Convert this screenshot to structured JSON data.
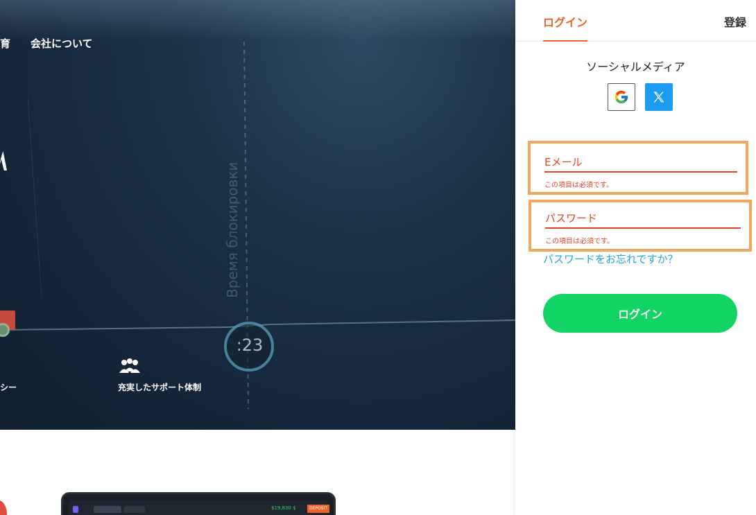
{
  "site": {
    "nav": [
      "育",
      "会社について"
    ],
    "features": [
      "シー",
      "充実したサポート体制"
    ],
    "chart_vertical_label": "Время блокировки",
    "timer": ":23"
  },
  "device_preview": {
    "balance": "$19,830 $",
    "deposit_label": "DEPOSIT"
  },
  "auth": {
    "tabs": {
      "login": "ログイン",
      "register": "登録"
    },
    "social_title": "ソーシャルメディア",
    "social_buttons": [
      {
        "icon": "google-icon",
        "label": "G"
      },
      {
        "icon": "x-icon",
        "label": "𝕏"
      }
    ],
    "email": {
      "label": "Eメール",
      "error": "この項目は必須です。"
    },
    "password": {
      "label": "パスワード",
      "error": "この項目は必須です。"
    },
    "forgot_link": "パスワードをお忘れですか？",
    "submit_label": "ログイン"
  },
  "colors": {
    "accent_orange": "#e8622a",
    "error_red": "#e04426",
    "highlight_border": "#f4a55f",
    "link_blue": "#1fa6d8",
    "submit_green": "#12d464",
    "x_blue": "#1d9bf0"
  }
}
